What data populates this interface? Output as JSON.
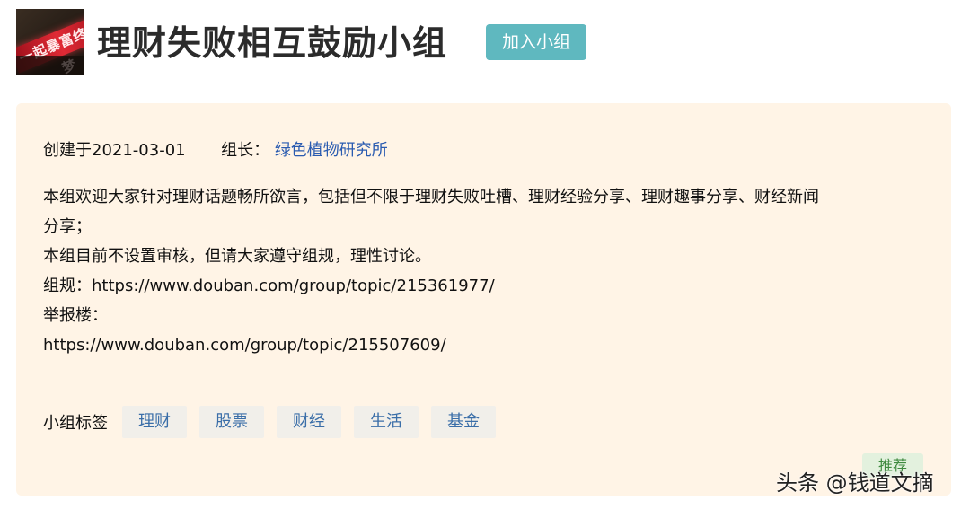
{
  "header": {
    "avatar_text": "一起暴富终是梦",
    "title": "理财失败相互鼓励小组",
    "join_label": "加入小组"
  },
  "meta": {
    "created": "创建于2021-03-01",
    "owner_label": "组长：",
    "owner_name": "绿色植物研究所"
  },
  "description": [
    "本组欢迎大家针对理财话题畅所欲言，包括但不限于理财失败吐槽、理财经验分享、理财趣事分享、财经新闻",
    "分享；",
    "本组目前不设置审核，但请大家遵守组规，理性讨论。",
    "组规：https://www.douban.com/group/topic/215361977/",
    "举报楼：",
    "https://www.douban.com/group/topic/215507609/"
  ],
  "tags": {
    "label": "小组标签",
    "items": [
      "理财",
      "股票",
      "财经",
      "生活",
      "基金"
    ]
  },
  "recommend_label": "推荐",
  "watermark": "头条 @钱道文摘"
}
